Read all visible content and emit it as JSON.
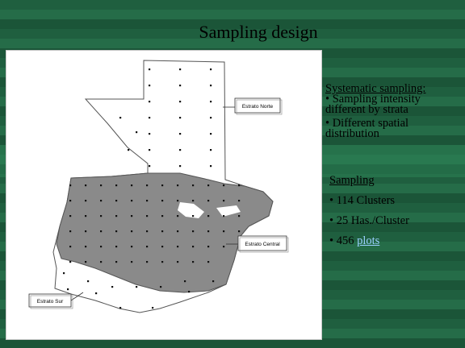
{
  "slide": {
    "title": "Sampling design"
  },
  "map": {
    "labels": {
      "norte": "Estrato Norte",
      "central": "Estrato Central",
      "sur": "Estrato Sur"
    }
  },
  "notes": {
    "systematic": {
      "heading": "Systematic sampling:",
      "bullets": [
        "• Sampling intensity different by strata",
        "• Different spatial distribution"
      ]
    },
    "sampling": {
      "heading": "Sampling",
      "clusters": "• 114 Clusters",
      "has_per_cluster": "• 25 Has./Cluster",
      "plots_prefix": "• 456 ",
      "plots_link": "plots"
    }
  }
}
